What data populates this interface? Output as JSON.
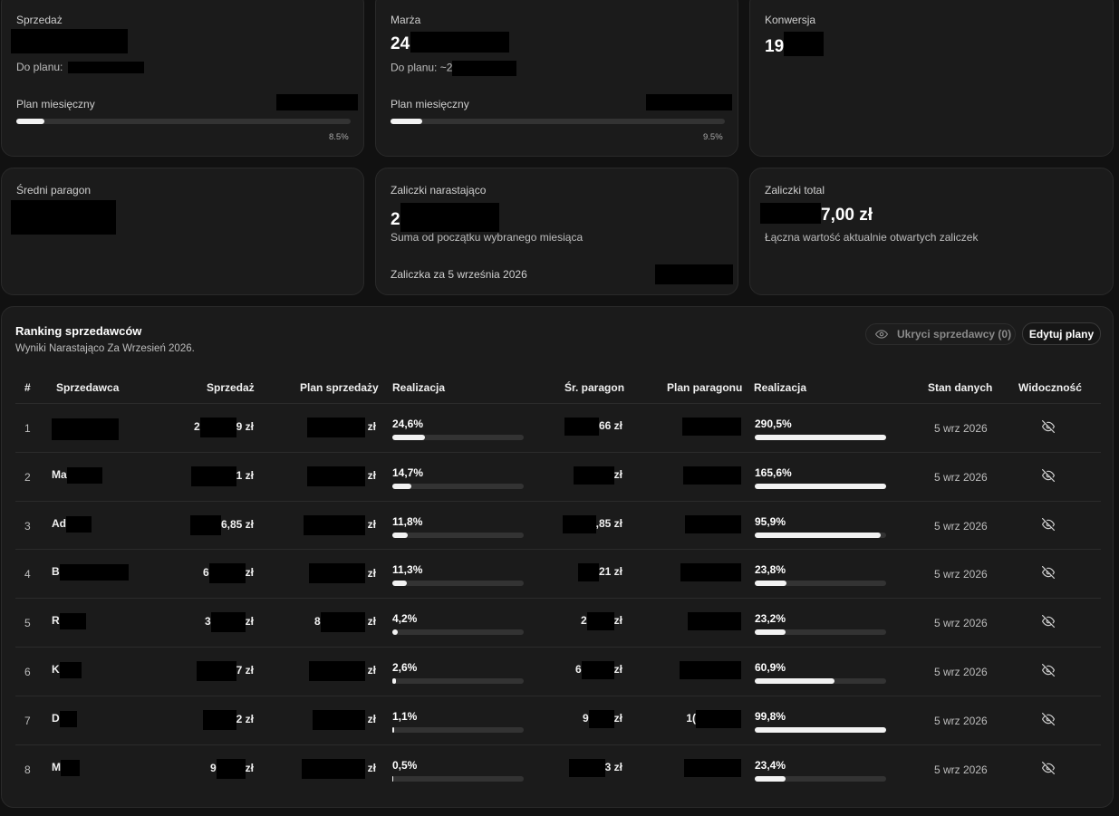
{
  "cards": {
    "sales": {
      "label": "Sprzedaż",
      "to_plan_label": "Do planu:",
      "monthly_plan_label": "Plan miesięczny",
      "progress": 8.5,
      "progress_text": "8.5%"
    },
    "margin": {
      "label": "Marża",
      "value_visible": "24",
      "to_plan_label": "Do planu: ~2",
      "monthly_plan_label": "Plan miesięczny",
      "progress": 9.5,
      "progress_text": "9.5%"
    },
    "conversion": {
      "label": "Konwersja",
      "value_visible": "19"
    },
    "avg_receipt": {
      "label": "Średni paragon"
    },
    "advances_cumulative": {
      "label": "Zaliczki narastająco",
      "value_visible": "2",
      "description": "Suma od początku wybranego miesiąca",
      "daily_label": "Zaliczka za 5 września 2026"
    },
    "advances_total": {
      "label": "Zaliczki total",
      "value_visible": "7,00 zł",
      "description": "Łączna wartość aktualnie otwartych zaliczek"
    }
  },
  "ranking": {
    "title": "Ranking sprzedawców",
    "subtitle": "Wyniki Narastająco Za Wrzesień 2026.",
    "hidden_button": "Ukryci sprzedawcy (0)",
    "edit_button": "Edytuj plany",
    "headers": [
      "#",
      "Sprzedawca",
      "Sprzedaż",
      "Plan sprzedaży",
      "Realizacja",
      "Śr. paragon",
      "Plan paragonu",
      "Realizacja",
      "Stan danych",
      "Widoczność"
    ],
    "rows": [
      {
        "rank": "1",
        "name": "",
        "sales": "2",
        "sales_end": "9 zł",
        "plan": "",
        "plan_end": "zł",
        "real": "24,6%",
        "real_val": 24.6,
        "avg": "",
        "avg_end": "66 zł",
        "avg_plan": "",
        "real2": "290,5%",
        "real2_val": 100,
        "date": "5 wrz 2026"
      },
      {
        "rank": "2",
        "name": "Ma",
        "sales": "",
        "sales_end": "1 zł",
        "plan": "",
        "plan_end": "zł",
        "real": "14,7%",
        "real_val": 14.7,
        "avg": "",
        "avg_end": "zł",
        "avg_plan": "",
        "real2": "165,6%",
        "real2_val": 100,
        "date": "5 wrz 2026"
      },
      {
        "rank": "3",
        "name": "Ad",
        "sales": "",
        "sales_end": "6,85 zł",
        "plan": "",
        "plan_end": "zł",
        "real": "11,8%",
        "real_val": 11.8,
        "avg": "",
        "avg_end": ",85 zł",
        "avg_plan": "",
        "real2": "95,9%",
        "real2_val": 95.9,
        "date": "5 wrz 2026"
      },
      {
        "rank": "4",
        "name": "B",
        "sales": "6",
        "sales_end": "zł",
        "plan": "",
        "plan_end": "zł",
        "real": "11,3%",
        "real_val": 11.3,
        "avg": "",
        "avg_end": "21 zł",
        "avg_plan": "",
        "real2": "23,8%",
        "real2_val": 23.8,
        "date": "5 wrz 2026"
      },
      {
        "rank": "5",
        "name": "R",
        "sales": "3",
        "sales_end": "zł",
        "plan": "8",
        "plan_end": "zł",
        "real": "4,2%",
        "real_val": 4.2,
        "avg": "2",
        "avg_end": "zł",
        "avg_plan": "",
        "real2": "23,2%",
        "real2_val": 23.2,
        "date": "5 wrz 2026"
      },
      {
        "rank": "6",
        "name": "K",
        "sales": "",
        "sales_end": "7 zł",
        "plan": "",
        "plan_end": "zł",
        "real": "2,6%",
        "real_val": 2.6,
        "avg": "6",
        "avg_end": "zł",
        "avg_plan": "",
        "real2": "60,9%",
        "real2_val": 60.9,
        "date": "5 wrz 2026"
      },
      {
        "rank": "7",
        "name": "D",
        "sales": "",
        "sales_end": "2 zł",
        "plan": "",
        "plan_end": "zł",
        "real": "1,1%",
        "real_val": 1.1,
        "avg": "9",
        "avg_end": "zł",
        "avg_plan": "1(",
        "real2": "99,8%",
        "real2_val": 99.8,
        "date": "5 wrz 2026"
      },
      {
        "rank": "8",
        "name": "M",
        "sales": "9",
        "sales_end": "zł",
        "plan": "",
        "plan_end": "zł",
        "real": "0,5%",
        "real_val": 0.5,
        "avg": "",
        "avg_end": "3 zł",
        "avg_plan": "",
        "real2": "23,4%",
        "real2_val": 23.4,
        "date": "5 wrz 2026"
      }
    ]
  },
  "icons": {
    "eye": "eye-icon",
    "eye_off": "eye-off-icon"
  },
  "colors": {
    "background": "#111111",
    "card": "#1b1b1b",
    "bar_track": "#333333",
    "bar_fill": "#f2f2f2"
  }
}
